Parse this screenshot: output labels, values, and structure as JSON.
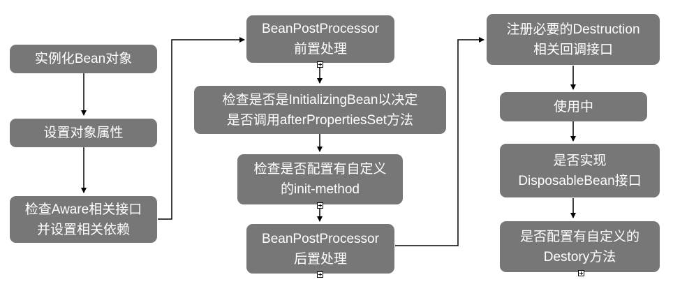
{
  "nodes": {
    "instantiate": {
      "lines": [
        "实例化Bean对象"
      ]
    },
    "set_props": {
      "lines": [
        "设置对象属性"
      ]
    },
    "aware": {
      "lines": [
        "检查Aware相关接口",
        "并设置相关依赖"
      ]
    },
    "bpp_before": {
      "lines": [
        "BeanPostProcessor",
        "前置处理"
      ]
    },
    "initializing": {
      "lines": [
        "检查是否是InitializingBean以决定",
        "是否调用afterPropertiesSet方法"
      ]
    },
    "init_method": {
      "lines": [
        "检查是否配置有自定义",
        "的init-method"
      ]
    },
    "bpp_after": {
      "lines": [
        "BeanPostProcessor",
        "后置处理"
      ]
    },
    "register_destruction": {
      "lines": [
        "注册必要的Destruction",
        "相关回调接口"
      ]
    },
    "in_use": {
      "lines": [
        "使用中"
      ]
    },
    "disposable": {
      "lines": [
        "是否实现",
        "DisposableBean接口"
      ]
    },
    "destroy_method": {
      "lines": [
        "是否配置有自定义的",
        "Destory方法"
      ]
    }
  },
  "colors": {
    "node_fill": "#777777",
    "node_text": "#ffffff",
    "connector": "#000000"
  }
}
